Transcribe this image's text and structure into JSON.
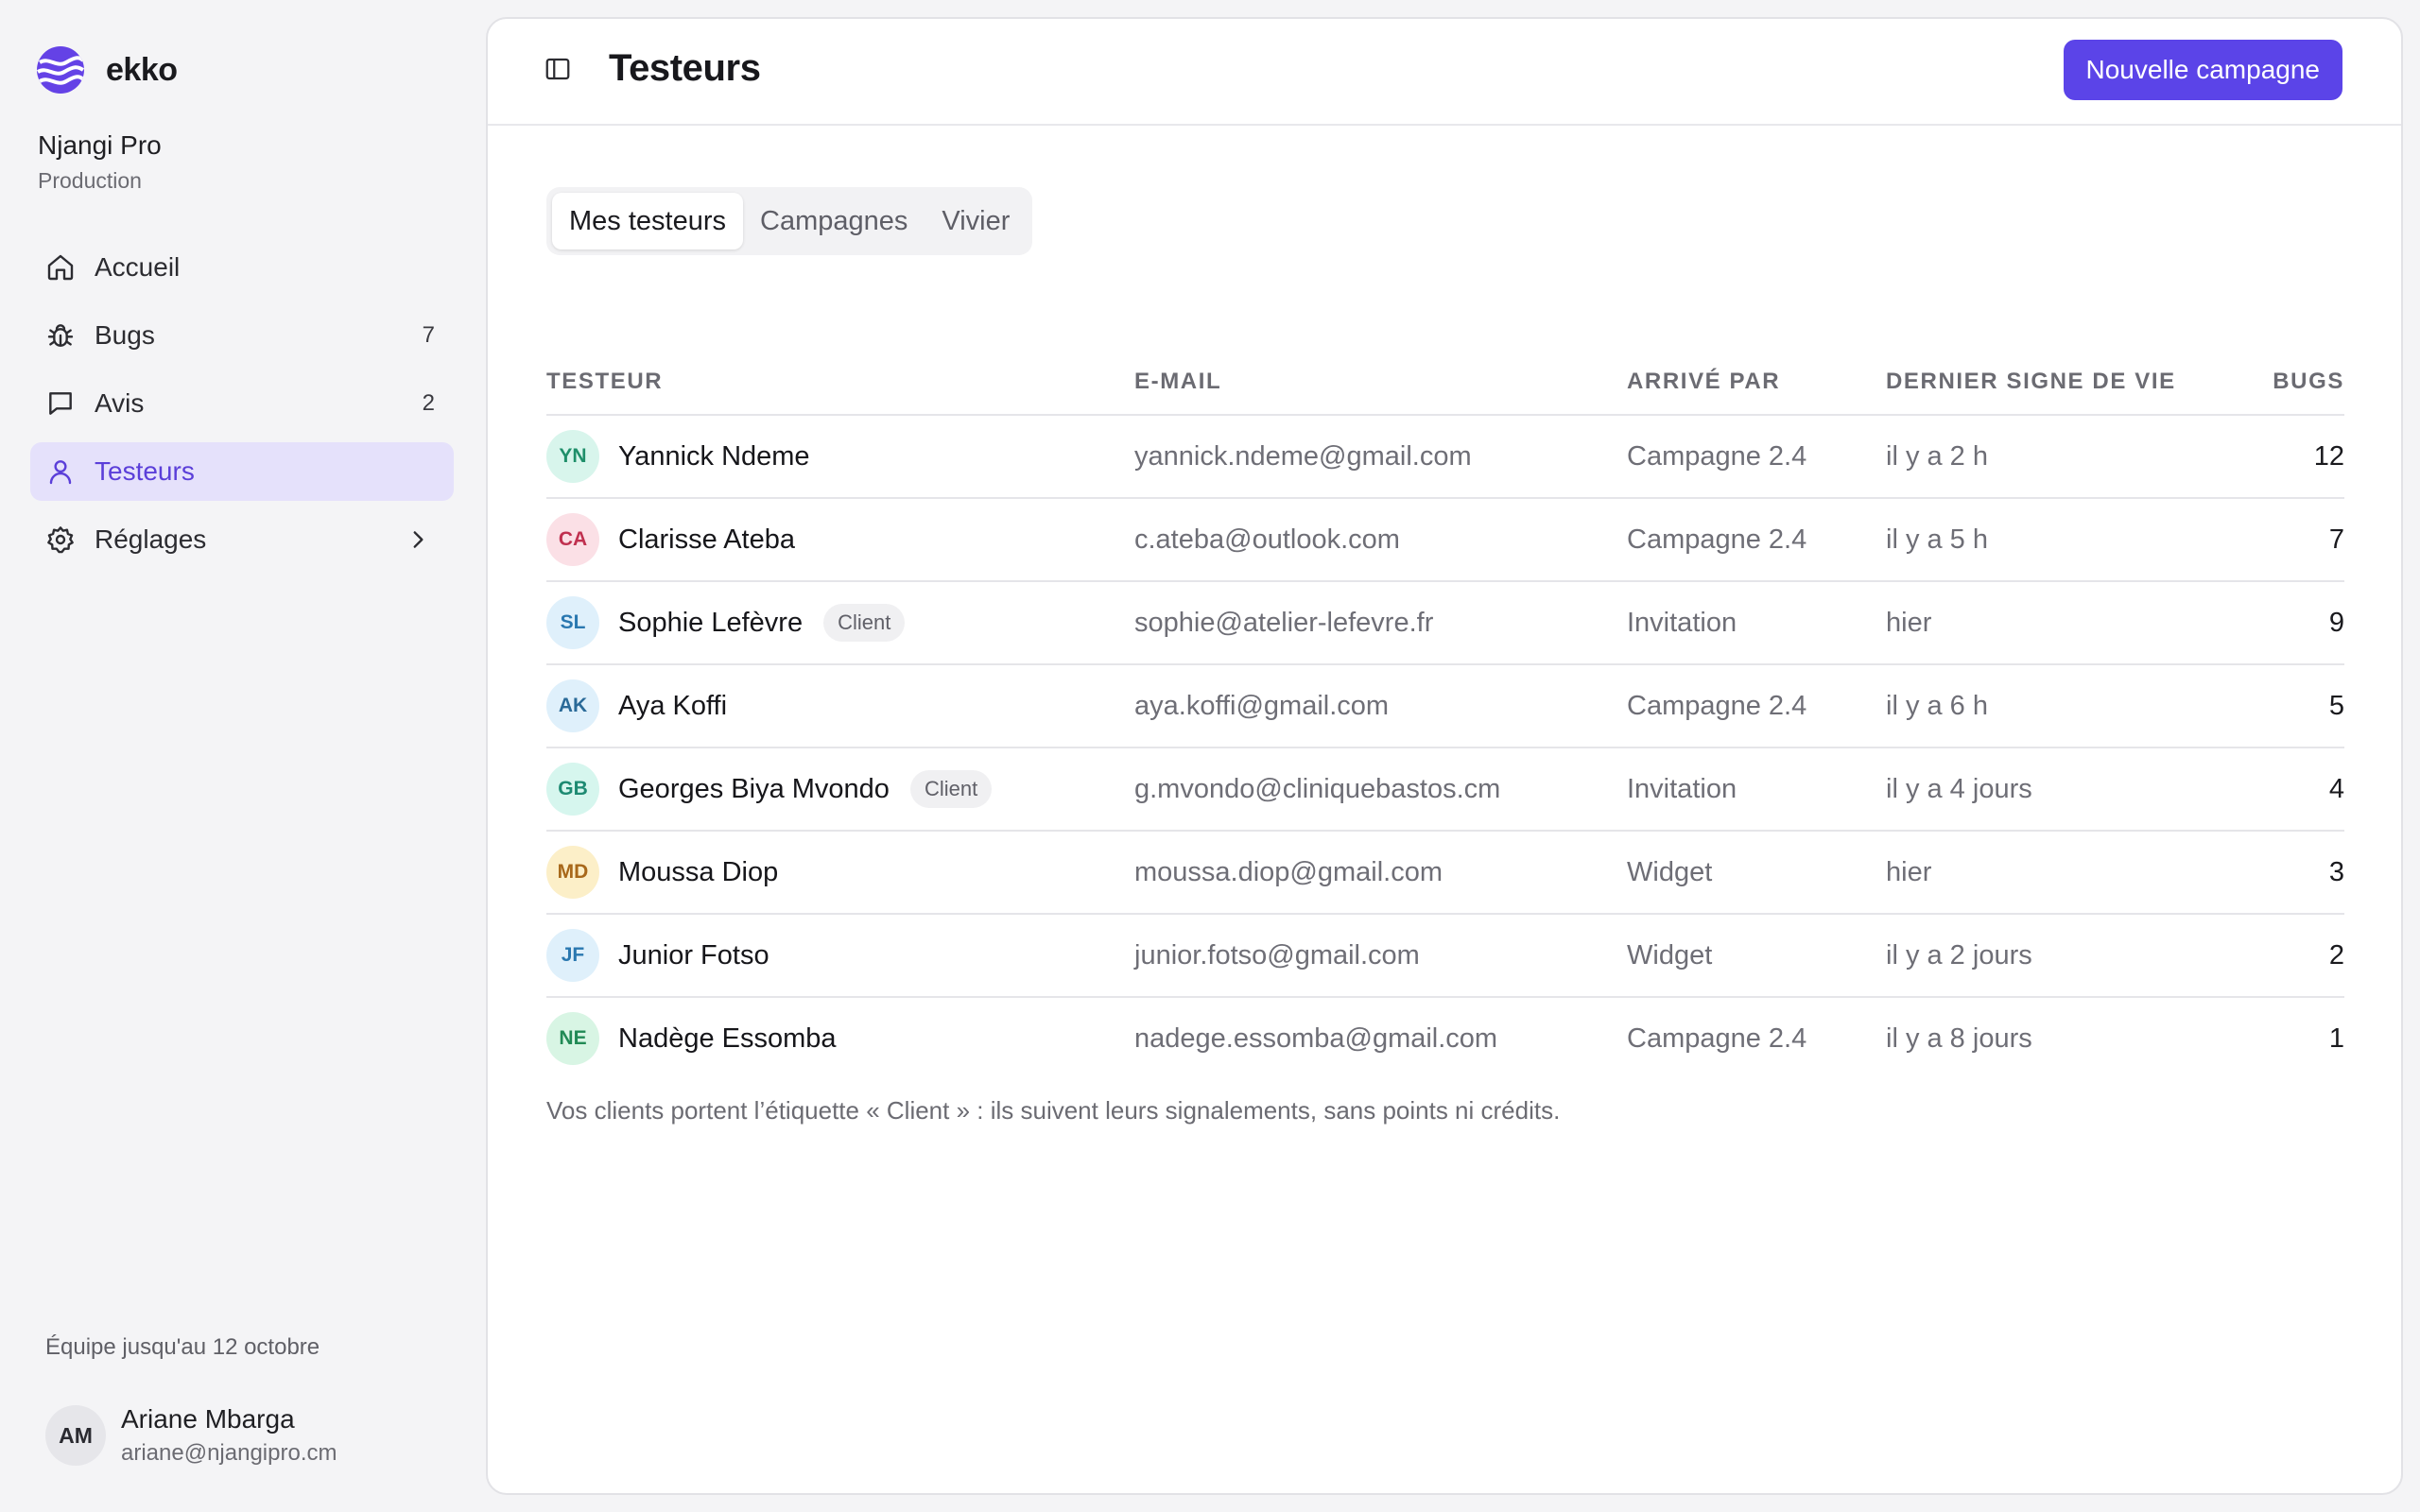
{
  "brand": {
    "name": "ekko",
    "logo_color": "#6442e6"
  },
  "workspace": {
    "name": "Njangi Pro",
    "environment": "Production"
  },
  "nav": [
    {
      "label": "Accueil",
      "icon": "home-icon",
      "count": ""
    },
    {
      "label": "Bugs",
      "icon": "bug-icon",
      "count": "7"
    },
    {
      "label": "Avis",
      "icon": "message-icon",
      "count": "2"
    },
    {
      "label": "Testeurs",
      "icon": "user-icon",
      "count": "",
      "active": true
    },
    {
      "label": "Réglages",
      "icon": "gear-icon",
      "count": "",
      "has_chevron": true
    }
  ],
  "team_note": "Équipe jusqu'au 12 octobre",
  "user": {
    "initials": "AM",
    "name": "Ariane Mbarga",
    "email": "ariane@njangipro.cm"
  },
  "header": {
    "title": "Testeurs",
    "primary_button": "Nouvelle campagne",
    "accent": "#5b44e8"
  },
  "tabs": [
    {
      "label": "Mes testeurs",
      "active": true
    },
    {
      "label": "Campagnes",
      "active": false
    },
    {
      "label": "Vivier",
      "active": false
    }
  ],
  "table": {
    "headers": {
      "tester": "TESTEUR",
      "email": "E-MAIL",
      "source": "ARRIVÉ PAR",
      "last_seen": "DERNIER SIGNE DE VIE",
      "bugs": "BUGS"
    },
    "rows": [
      {
        "initials": "YN",
        "name": "Yannick Ndeme",
        "badge": "",
        "email": "yannick.ndeme@gmail.com",
        "source": "Campagne 2.4",
        "last_seen": "il y a 2 h",
        "bugs": "12",
        "avatar_bg": "#d8f5ec",
        "avatar_fg": "#1f8f6a"
      },
      {
        "initials": "CA",
        "name": "Clarisse Ateba",
        "badge": "",
        "email": "c.ateba@outlook.com",
        "source": "Campagne 2.4",
        "last_seen": "il y a 5 h",
        "bugs": "7",
        "avatar_bg": "#fbe0e6",
        "avatar_fg": "#c0304f"
      },
      {
        "initials": "SL",
        "name": "Sophie Lefèvre",
        "badge": "Client",
        "email": "sophie@atelier-lefevre.fr",
        "source": "Invitation",
        "last_seen": "hier",
        "bugs": "9",
        "avatar_bg": "#dff0fb",
        "avatar_fg": "#2a78b0"
      },
      {
        "initials": "AK",
        "name": "Aya Koffi",
        "badge": "",
        "email": "aya.koffi@gmail.com",
        "source": "Campagne 2.4",
        "last_seen": "il y a 6 h",
        "bugs": "5",
        "avatar_bg": "#dff0fb",
        "avatar_fg": "#2a6a98"
      },
      {
        "initials": "GB",
        "name": "Georges Biya Mvondo",
        "badge": "Client",
        "email": "g.mvondo@cliniquebastos.cm",
        "source": "Invitation",
        "last_seen": "il y a 4 jours",
        "bugs": "4",
        "avatar_bg": "#d6f6ee",
        "avatar_fg": "#1d8a72"
      },
      {
        "initials": "MD",
        "name": "Moussa Diop",
        "badge": "",
        "email": "moussa.diop@gmail.com",
        "source": "Widget",
        "last_seen": "hier",
        "bugs": "3",
        "avatar_bg": "#fcefc8",
        "avatar_fg": "#a8681a"
      },
      {
        "initials": "JF",
        "name": "Junior Fotso",
        "badge": "",
        "email": "junior.fotso@gmail.com",
        "source": "Widget",
        "last_seen": "il y a 2 jours",
        "bugs": "2",
        "avatar_bg": "#dff0fb",
        "avatar_fg": "#2a78b0"
      },
      {
        "initials": "NE",
        "name": "Nadège Essomba",
        "badge": "",
        "email": "nadege.essomba@gmail.com",
        "source": "Campagne 2.4",
        "last_seen": "il y a 8 jours",
        "bugs": "1",
        "avatar_bg": "#d8f5e4",
        "avatar_fg": "#218a55"
      }
    ]
  },
  "footnote": "Vos clients portent l’étiquette « Client » : ils suivent leurs signalements, sans points ni crédits."
}
